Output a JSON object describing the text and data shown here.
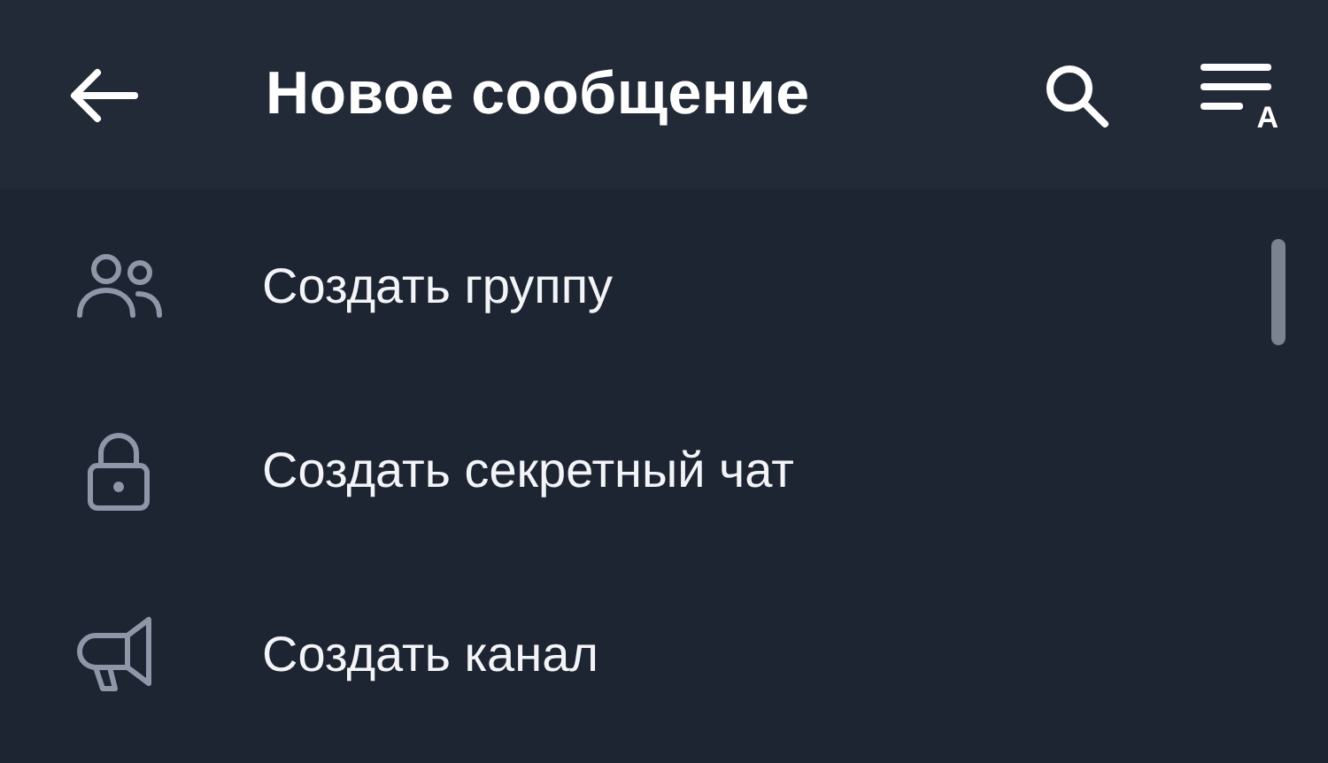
{
  "header": {
    "title": "Новое сообщение",
    "sort_letter": "A"
  },
  "items": [
    {
      "kind": "group",
      "label": "Создать группу"
    },
    {
      "kind": "secret",
      "label": "Создать секретный чат"
    },
    {
      "kind": "channel",
      "label": "Создать канал"
    }
  ]
}
